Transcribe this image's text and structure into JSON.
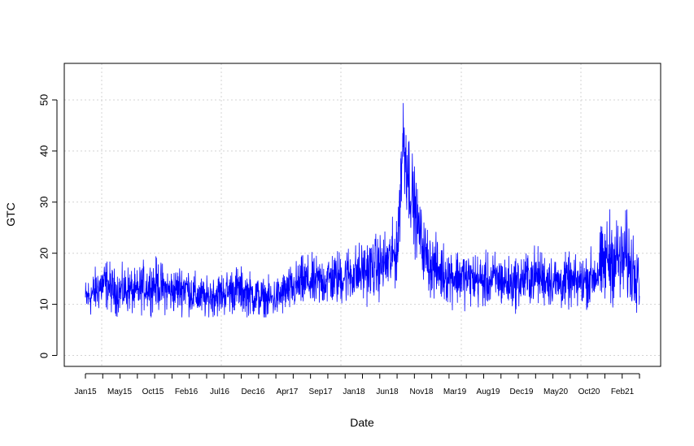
{
  "chart_data": {
    "type": "line",
    "title": "",
    "xlabel": "Date",
    "ylabel": "GTC",
    "ylim": [
      -2,
      57
    ],
    "y_ticks": [
      0,
      10,
      20,
      30,
      40,
      50
    ],
    "x_tick_labels": [
      "Jan15",
      "May15",
      "Oct15",
      "Feb16",
      "Jul16",
      "Dec16",
      "Apr17",
      "Sep17",
      "Jan18",
      "Jun18",
      "Nov18",
      "Mar19",
      "Aug19",
      "Dec19",
      "May20",
      "Oct20",
      "Feb21"
    ],
    "grid": true,
    "legend": "none",
    "series_color": "#0000ff",
    "series": [
      {
        "values": [
          [
            0,
            11
          ],
          [
            8,
            12
          ],
          [
            16,
            13.5
          ],
          [
            24,
            14
          ],
          [
            32,
            12.5
          ],
          [
            40,
            12.5
          ],
          [
            48,
            13
          ],
          [
            56,
            12
          ],
          [
            64,
            13.5
          ],
          [
            72,
            13.5
          ],
          [
            80,
            14
          ],
          [
            88,
            13
          ],
          [
            96,
            12.5
          ],
          [
            104,
            13
          ],
          [
            112,
            13.5
          ],
          [
            120,
            12
          ],
          [
            128,
            11.5
          ],
          [
            136,
            11
          ],
          [
            144,
            12
          ],
          [
            152,
            12
          ],
          [
            160,
            12.5
          ],
          [
            168,
            13
          ],
          [
            176,
            12.5
          ],
          [
            184,
            12
          ],
          [
            192,
            11.5
          ],
          [
            200,
            11
          ],
          [
            208,
            11
          ],
          [
            216,
            11.5
          ],
          [
            224,
            12.5
          ],
          [
            232,
            13
          ],
          [
            240,
            14
          ],
          [
            248,
            14.5
          ],
          [
            256,
            14
          ],
          [
            264,
            14.5
          ],
          [
            272,
            15
          ],
          [
            280,
            15
          ],
          [
            288,
            15.5
          ],
          [
            296,
            16
          ],
          [
            304,
            16
          ],
          [
            312,
            16.5
          ],
          [
            320,
            17
          ],
          [
            328,
            17.5
          ],
          [
            336,
            18
          ],
          [
            344,
            19
          ],
          [
            350,
            22
          ],
          [
            352,
            32
          ],
          [
            355,
            42
          ],
          [
            358,
            40
          ],
          [
            362,
            35
          ],
          [
            366,
            31
          ],
          [
            370,
            27
          ],
          [
            374,
            24
          ],
          [
            378,
            21
          ],
          [
            382,
            19
          ],
          [
            388,
            17.5
          ],
          [
            396,
            16.5
          ],
          [
            404,
            16
          ],
          [
            412,
            15.5
          ],
          [
            420,
            15.5
          ],
          [
            428,
            15
          ],
          [
            436,
            15
          ],
          [
            444,
            14.5
          ],
          [
            452,
            14.5
          ],
          [
            460,
            15
          ],
          [
            468,
            14.5
          ],
          [
            476,
            14
          ],
          [
            484,
            14.5
          ],
          [
            492,
            15
          ],
          [
            500,
            15.5
          ],
          [
            508,
            15.5
          ],
          [
            516,
            15
          ],
          [
            524,
            14.5
          ],
          [
            532,
            14
          ],
          [
            540,
            14.5
          ],
          [
            548,
            14
          ],
          [
            556,
            14.5
          ],
          [
            564,
            15
          ],
          [
            572,
            16
          ],
          [
            580,
            17.5
          ],
          [
            584,
            19
          ],
          [
            588,
            19.5
          ],
          [
            592,
            18.5
          ],
          [
            596,
            19
          ],
          [
            600,
            18
          ],
          [
            604,
            19.5
          ],
          [
            608,
            18
          ],
          [
            612,
            17
          ],
          [
            618,
            18
          ],
          [
            620,
            16
          ]
        ]
      }
    ]
  }
}
